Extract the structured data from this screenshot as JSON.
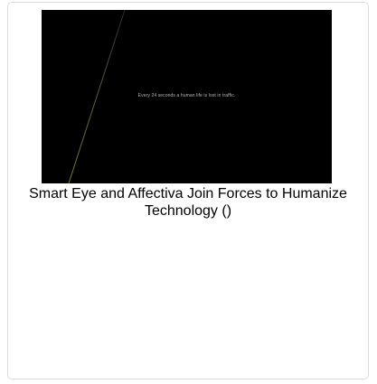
{
  "video": {
    "thumbnail_text": "Every 24 seconds a human life is lost in traffic."
  },
  "article": {
    "title": "Smart Eye and Affectiva Join Forces to Humanize Technology ()"
  }
}
